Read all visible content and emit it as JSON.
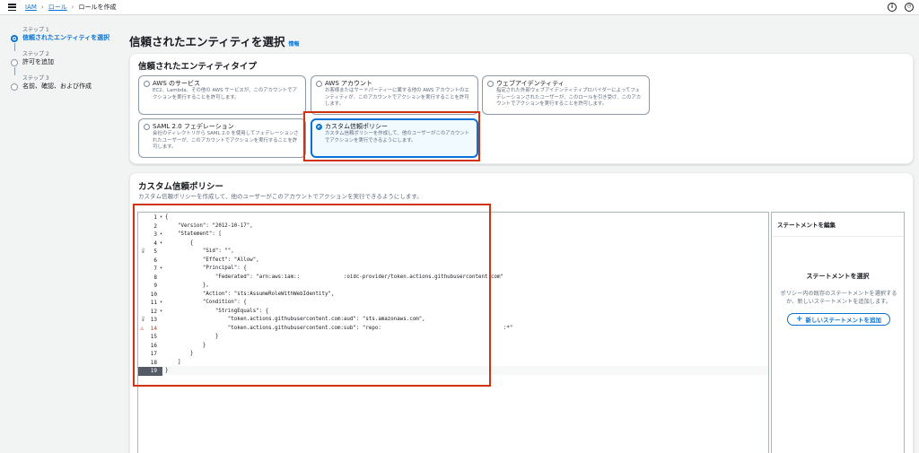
{
  "breadcrumb": {
    "iam": "IAM",
    "roles": "ロール",
    "current": "ロールを作成"
  },
  "steps": [
    {
      "num": "ステップ 1",
      "label": "信頼されたエンティティを選択",
      "active": true
    },
    {
      "num": "ステップ 2",
      "label": "許可を追加",
      "active": false
    },
    {
      "num": "ステップ 3",
      "label": "名前、確認、および作成",
      "active": false
    }
  ],
  "page": {
    "title": "信頼されたエンティティを選択",
    "info": "情報"
  },
  "entity_type": {
    "title": "信頼されたエンティティタイプ",
    "options": [
      {
        "title": "AWS のサービス",
        "desc": "EC2、Lambda、その他の AWS サービスが、このアカウントでアクションを実行することを許可します。"
      },
      {
        "title": "AWS アカウント",
        "desc": "お客様またはサードパーティーに属する他の AWS アカウントのエンティティが、このアカウントでアクションを実行することを許可します。"
      },
      {
        "title": "ウェブアイデンティティ",
        "desc": "指定された外部ウェブアイデンティティプロバイダーによってフェデレーションされたユーザーが、このロールを引き受け、このアカウントでアクションを実行することを許可します。"
      },
      {
        "title": "SAML 2.0 フェデレーション",
        "desc": "会社のディレクトリから SAML 2.0 を使用してフェデレーションされたユーザーが、このアカウントでアクションを実行することを許可します。"
      },
      {
        "title": "カスタム信頼ポリシー",
        "desc": "カスタム信頼ポリシーを作成して、他のユーザーがこのアカウントでアクションを実行できるようにします。",
        "selected": true
      }
    ]
  },
  "custom_policy": {
    "title": "カスタム信頼ポリシー",
    "desc": "カスタム信頼ポリシーを作成して、他のユーザーがこのアカウントでアクションを実行できるようにします。",
    "code": [
      "{",
      "    \"Version\": \"2012-10-17\",",
      "    \"Statement\": [",
      "        {",
      "            \"Sid\": \"\",",
      "            \"Effect\": \"Allow\",",
      "            \"Principal\": {",
      "                \"Federated\": \"arn:aws:iam::              :oidc-provider/token.actions.githubusercontent.com\"",
      "            },",
      "            \"Action\": \"sts:AssumeRoleWithWebIdentity\",",
      "            \"Condition\": {",
      "                \"StringEquals\": {",
      "                    \"token.actions.githubusercontent.com:aud\": \"sts.amazonaws.com\",",
      "                    \"token.actions.githubusercontent.com:sub\": \"repo:                                       :*\"",
      "                }",
      "            }",
      "        }",
      "    ]",
      "}"
    ]
  },
  "statement_panel": {
    "title": "ステートメントを編集",
    "heading": "ステートメントを選択",
    "body": "ポリシー内の既存のステートメントを選択するか、新しいステートメントを追加します。",
    "button": "新しいステートメントを追加"
  },
  "colors": {
    "accent": "#0972d3",
    "highlight": "#d13212",
    "warning": "#d13212"
  },
  "icons": {
    "hint_lines": [
      5,
      13
    ],
    "warning_line": 14,
    "fold_lines": [
      1,
      3,
      4,
      7,
      11,
      12
    ],
    "current_line": 19
  }
}
